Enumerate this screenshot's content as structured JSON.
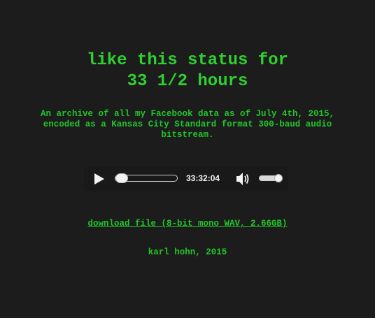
{
  "title": {
    "line1": "like this status for",
    "line2": "33 1/2 hours"
  },
  "description": {
    "line1": "An archive of all my Facebook data as of July 4th, 2015,",
    "line2": "encoded as a Kansas City Standard format 300-baud audio",
    "line3": "bitstream."
  },
  "player": {
    "play_icon": "play-icon",
    "progress_fraction": 0,
    "time": "33:32:04",
    "volume_icon": "speaker-volume-icon",
    "volume_fraction": 1
  },
  "download": {
    "label": "download file (8-bit mono WAV, 2.66GB)"
  },
  "credit": {
    "text": "karl hohn, 2015"
  },
  "colors": {
    "background": "#1c1c1c",
    "text_green": "#22c52a",
    "title_green": "#2fd02f"
  }
}
